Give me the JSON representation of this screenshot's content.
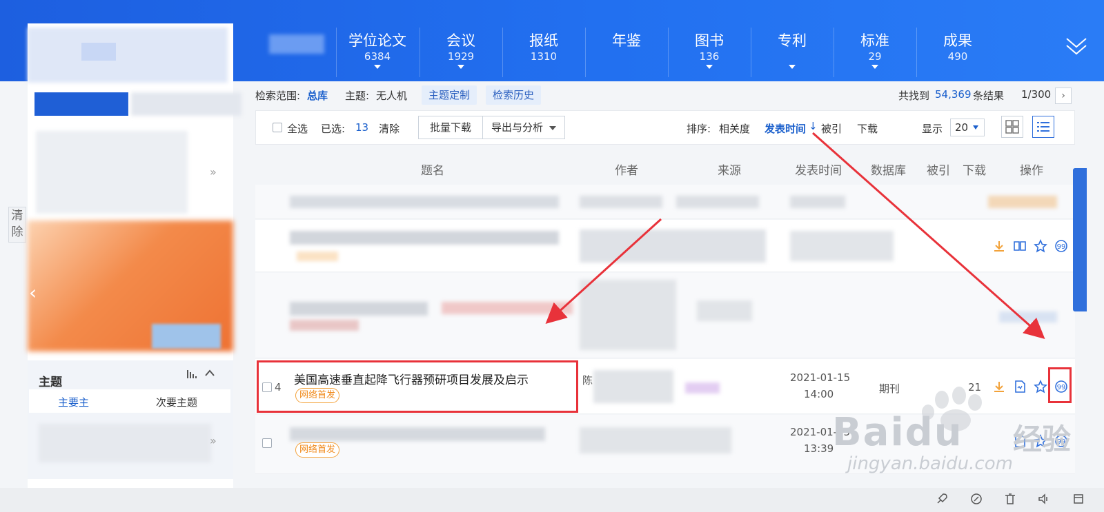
{
  "nav": {
    "tabs": [
      {
        "label": "学位论文",
        "count": "6384",
        "caret": true
      },
      {
        "label": "会议",
        "count": "1929",
        "caret": true
      },
      {
        "label": "报纸",
        "count": "1310",
        "caret": false
      },
      {
        "label": "年鉴",
        "count": "",
        "caret": false
      },
      {
        "label": "图书",
        "count": "136",
        "caret": true
      },
      {
        "label": "专利",
        "count": "",
        "caret": true
      },
      {
        "label": "标准",
        "count": "29",
        "caret": true
      },
      {
        "label": "成果",
        "count": "490",
        "caret": false
      }
    ]
  },
  "left": {
    "clear_label": "清除",
    "topic_title": "主题",
    "tab_primary": "主要主",
    "tab_secondary": "次要主题"
  },
  "filter": {
    "scope_label": "检索范围:",
    "scope_value": "总库",
    "topic_label": "主题:",
    "topic_value": "无人机",
    "custom_topic": "主题定制",
    "history": "检索历史",
    "found_prefix": "共找到",
    "found_count": "54,369",
    "found_suffix": "条结果",
    "page": "1/300"
  },
  "toolbar": {
    "select_all": "全选",
    "selected_label": "已选:",
    "selected_count": "13",
    "clear": "清除",
    "batch_download": "批量下载",
    "export": "导出与分析",
    "sort_label": "排序:",
    "sort_relevance": "相关度",
    "sort_time": "发表时间",
    "sort_cited": "被引",
    "sort_download": "下载",
    "display_label": "显示",
    "display_value": "20"
  },
  "table": {
    "headers": {
      "title": "题名",
      "author": "作者",
      "source": "来源",
      "date": "发表时间",
      "db": "数据库",
      "cited": "被引",
      "download": "下载",
      "ops": "操作"
    },
    "rows": [
      {
        "num": "4",
        "title": "美国高速垂直起降飞行器预研项目发展及启示",
        "badge": "网络首发",
        "author_fragment": "陈",
        "date": "2021-01-15",
        "time": "14:00",
        "db": "期刊",
        "downloads": "21"
      },
      {
        "badge": "网络首发",
        "date": "2021-01-15",
        "time": "13:39"
      }
    ]
  },
  "watermark": {
    "brand": "Baidu",
    "brand_cn": "经验",
    "url": "jingyan.baidu.com"
  },
  "colors": {
    "nav_blue": "#2270f0",
    "link_blue": "#1a5fcc",
    "highlight_red": "#e8323a",
    "badge_orange": "#f08a1c"
  }
}
